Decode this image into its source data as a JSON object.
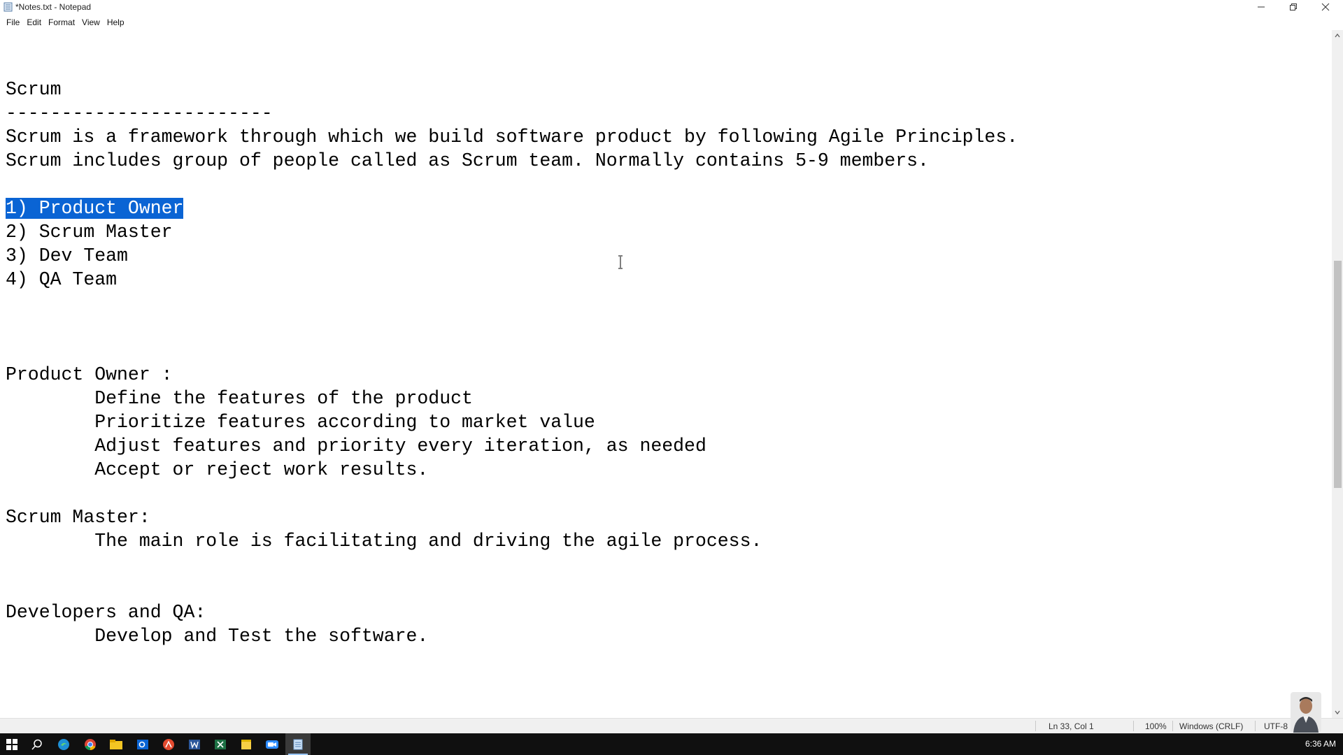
{
  "window": {
    "title": "*Notes.txt - Notepad",
    "controls": [
      "minimize-icon",
      "restore-icon",
      "close-icon"
    ]
  },
  "menu": [
    {
      "label": "File"
    },
    {
      "label": "Edit"
    },
    {
      "label": "Format"
    },
    {
      "label": "View"
    },
    {
      "label": "Help"
    }
  ],
  "document": {
    "lines": [
      "",
      "Scrum",
      "------------------------",
      "Scrum is a framework through which we build software product by following Agile Principles.",
      "Scrum includes group of people called as Scrum team. Normally contains 5-9 members.",
      "",
      "1) Product Owner",
      "2) Scrum Master",
      "3) Dev Team",
      "4) QA Team",
      "",
      "",
      "",
      "Product Owner :",
      "        Define the features of the product",
      "        Prioritize features according to market value",
      "        Adjust features and priority every iteration, as needed",
      "        Accept or reject work results.",
      "",
      "Scrum Master:",
      "        The main role is facilitating and driving the agile process.",
      "",
      "",
      "Developers and QA:",
      "        Develop and Test the software."
    ],
    "selected_line_index": 6,
    "selection_color": "#0a64d4"
  },
  "status": {
    "position": "Ln 33, Col 1",
    "zoom": "100%",
    "line_ending": "Windows (CRLF)",
    "encoding": "UTF-8"
  },
  "taskbar": {
    "icons": [
      "windows-start-icon",
      "search-icon",
      "edge-icon",
      "chrome-icon",
      "file-explorer-icon",
      "outlook-icon",
      "acrobat-icon",
      "word-icon",
      "excel-icon",
      "sticky-notes-icon",
      "zoom-icon",
      "notepad-icon"
    ],
    "clock": "6:36 AM"
  }
}
